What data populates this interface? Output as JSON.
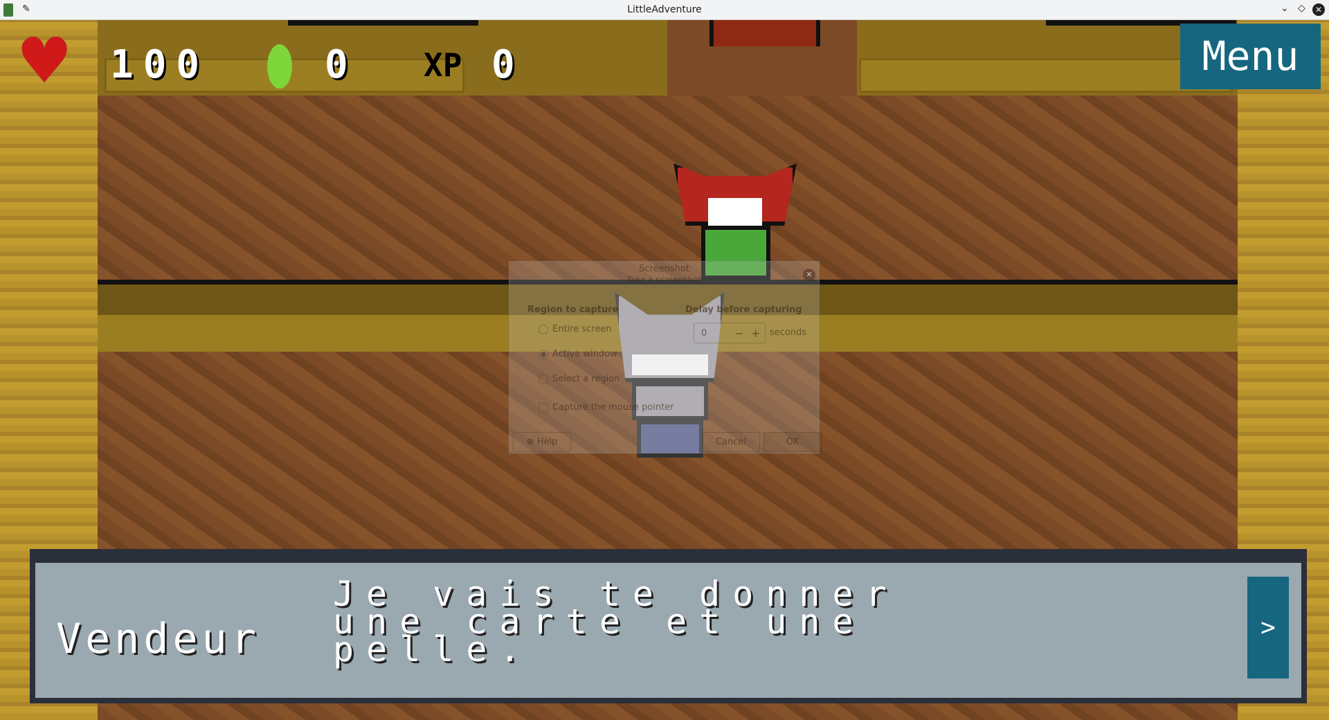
{
  "window": {
    "title": "LittleAdventure",
    "icons": [
      "app-icon",
      "pin-icon",
      "minimize-icon",
      "maximize-icon",
      "close-icon"
    ]
  },
  "hud": {
    "health": "100",
    "gems": "0",
    "xp": "0",
    "menu_label": "Menu",
    "icons": [
      "heart-icon",
      "gem-icon",
      "xp-icon"
    ]
  },
  "dialogue": {
    "speaker": "Vendeur",
    "text": "Je vais te donner une carte et une pelle.",
    "next_label": ">"
  },
  "screenshot_dialog": {
    "title": "Screenshot",
    "subtitle": "Take a screenshot",
    "region_heading": "Region to capture",
    "options": [
      "Entire screen",
      "Active window",
      "Select a region"
    ],
    "selected": "Active window",
    "pointer_label": "Capture the mouse pointer",
    "delay_heading": "Delay before capturing",
    "delay_value": "0",
    "delay_unit": "seconds",
    "minus": "−",
    "plus": "+",
    "help_label": "Help",
    "cancel_label": "Cancel",
    "ok_label": "OK"
  },
  "colors": {
    "menu": "#16667f",
    "dialog_bg": "#9aa8b0",
    "heart": "#d01a1a",
    "gem": "#7ed63a"
  }
}
